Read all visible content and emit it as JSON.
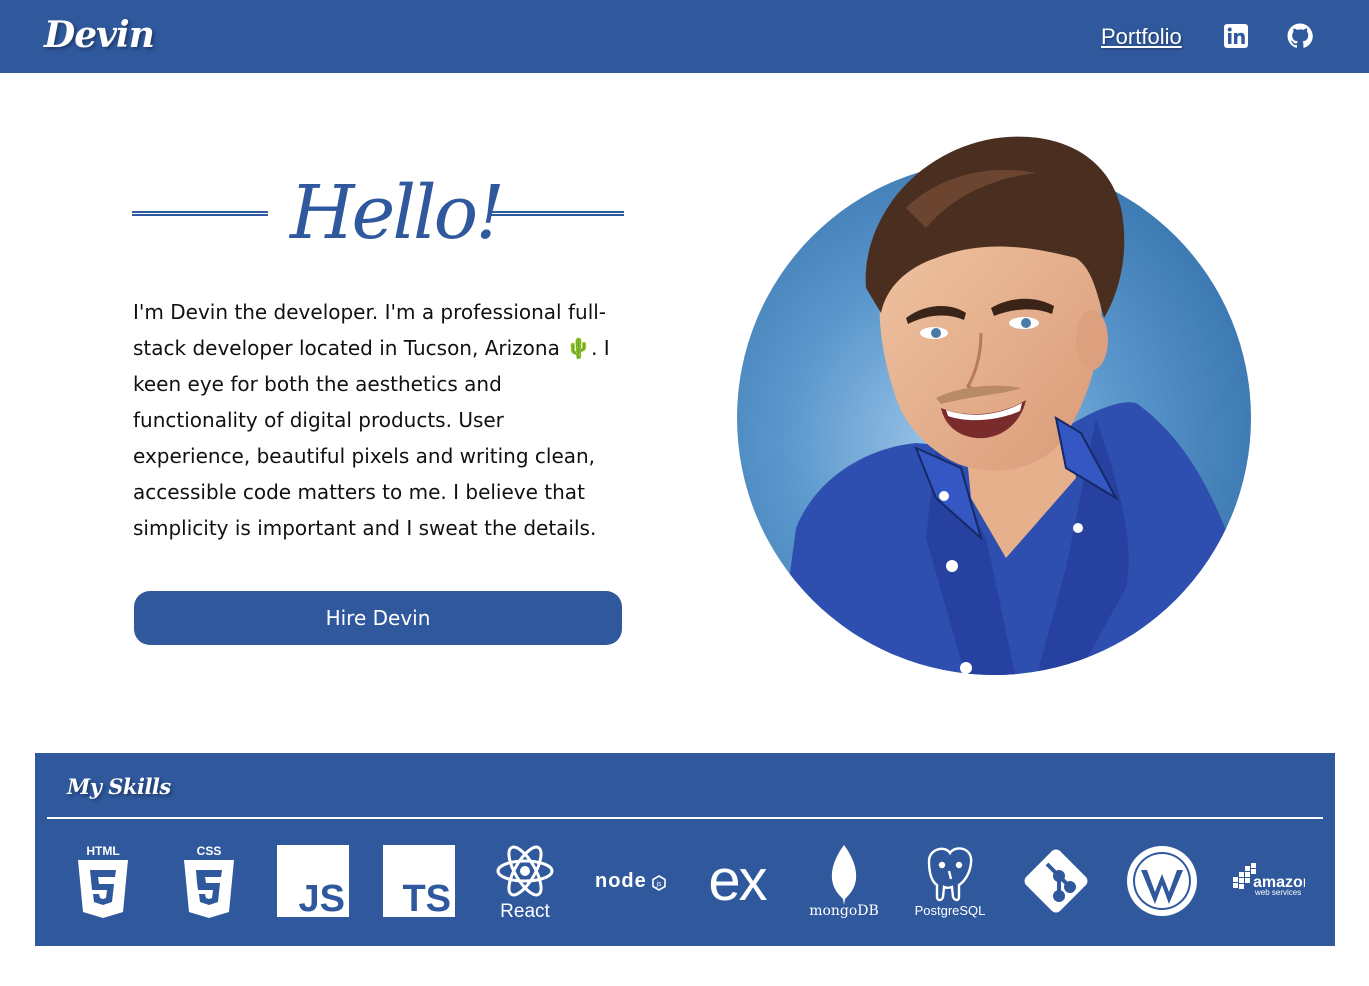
{
  "header": {
    "logo": "Devin",
    "nav_portfolio": "Portfolio",
    "linkedin_icon": "linkedin-icon",
    "github_icon": "github-icon"
  },
  "hero": {
    "heading": "Hello!",
    "intro_part1": "I'm Devin the developer. I'm a professional full-stack developer located in Tucson, Arizona ",
    "cactus": "🌵",
    "intro_part2": ". I keen eye for both the aesthetics and functionality of digital products. User experience, beautiful pixels and writing clean, accessible code matters to me. I believe that simplicity is important and I sweat the details.",
    "hire_button": "Hire Devin",
    "avatar": "developer-avatar-illustration"
  },
  "skills": {
    "title": "My Skills",
    "items": [
      {
        "name": "html5-icon",
        "label": "HTML"
      },
      {
        "name": "css3-icon",
        "label": "CSS"
      },
      {
        "name": "javascript-icon",
        "label": "JS"
      },
      {
        "name": "typescript-icon",
        "label": "TS"
      },
      {
        "name": "react-icon",
        "label": "React"
      },
      {
        "name": "nodejs-icon",
        "label": "node"
      },
      {
        "name": "express-icon",
        "label": "ex"
      },
      {
        "name": "mongodb-icon",
        "label": "mongoDB"
      },
      {
        "name": "postgresql-icon",
        "label": "PostgreSQL"
      },
      {
        "name": "git-icon",
        "label": ""
      },
      {
        "name": "wordpress-icon",
        "label": ""
      },
      {
        "name": "aws-icon",
        "label": "amazon",
        "sub": "web services"
      }
    ]
  },
  "colors": {
    "brand": "#2f589d",
    "background": "#ffffff",
    "text": "#111111"
  }
}
